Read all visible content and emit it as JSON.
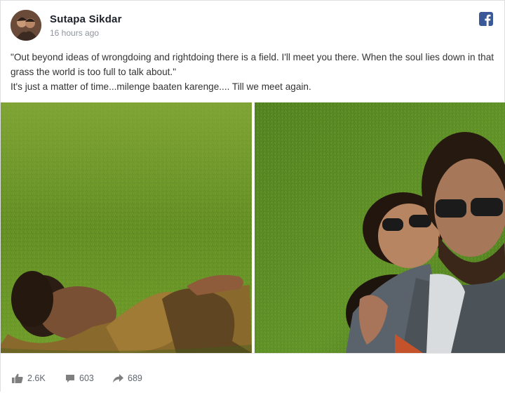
{
  "post": {
    "author_name": "Sutapa Sikdar",
    "timestamp": "16 hours ago",
    "platform_icon": "facebook-icon",
    "caption_line1": "\"Out beyond ideas of wrongdoing and rightdoing there is a field. I'll meet you there. When the soul lies down in that grass the world is too full to talk about.\"",
    "caption_line2": "It's just a matter of time...milenge baaten karenge.... Till we meet again."
  },
  "stats": {
    "likes": "2.6K",
    "comments": "603",
    "shares": "689"
  },
  "colors": {
    "facebook_blue": "#3b5998",
    "grass_green": "#6f9b2e",
    "text_grey": "#606770"
  }
}
